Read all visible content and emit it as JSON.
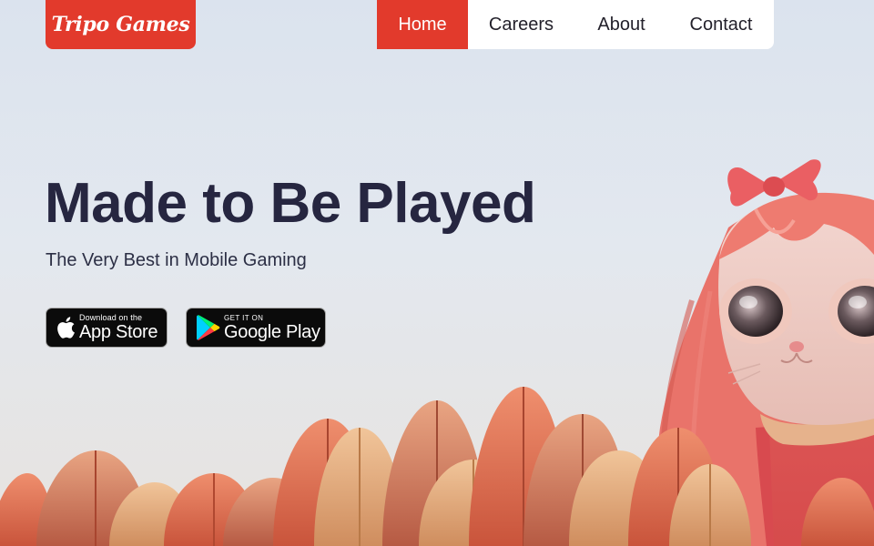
{
  "brand": {
    "logo_text": "Tripo Games"
  },
  "nav": {
    "items": [
      {
        "label": "Home",
        "active": true
      },
      {
        "label": "Careers",
        "active": false
      },
      {
        "label": "About",
        "active": false
      },
      {
        "label": "Contact",
        "active": false
      }
    ]
  },
  "hero": {
    "headline": "Made to Be Played",
    "subheadline": "The Very Best in Mobile Gaming",
    "illustration": "cat-character-with-bow-in-autumn-leaves"
  },
  "store_badges": {
    "app_store": {
      "small_text": "Download on the",
      "big_text": "App Store",
      "icon": "apple-icon"
    },
    "google_play": {
      "small_text": "GET IT ON",
      "big_text": "Google Play",
      "icon": "play-triangle-icon"
    }
  },
  "colors": {
    "accent": "#e23a2c",
    "headline": "#262640",
    "nav_bg": "#ffffff",
    "badge_bg": "#0b0b0b"
  }
}
